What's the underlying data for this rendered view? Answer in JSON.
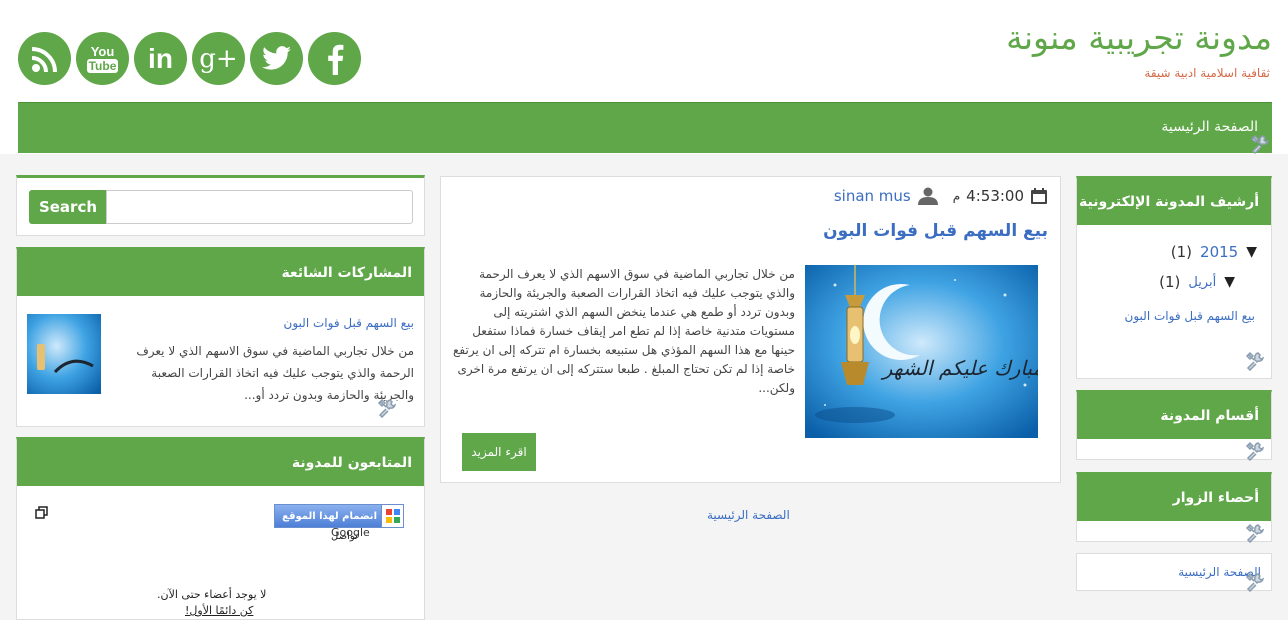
{
  "header": {
    "blog_title": "مدونة تجريبية منونة",
    "blog_description": "ثقافية اسلامية ادبية شيقة",
    "social_icons": [
      "rss-icon",
      "youtube-icon",
      "linkedin-icon",
      "google-plus-icon",
      "twitter-icon",
      "facebook-icon"
    ],
    "youtube_text_top": "You",
    "youtube_text_bottom": "Tube",
    "linkedin_text": "in",
    "gplus_text": "g+"
  },
  "nav": {
    "home": "الصفحة الرئيسية"
  },
  "right_sidebar": {
    "archive_title": "أرشيف المدونة الإلكترونية",
    "year": "2015",
    "year_count": "(1)",
    "month": "أبريل",
    "month_count": "(1)",
    "post": "بيع السهم قبل فوات البون",
    "sections_title": "أقسام المدونة",
    "stats_title": "أحصاء الزوار",
    "home_link": "الصفحة الرئيسية"
  },
  "post": {
    "time": "4:53:00",
    "ampm": "م",
    "author": "sinan mus",
    "title": "بيع السهم قبل فوات البون",
    "excerpt": "من خلال تجاربي الماضية في سوق الاسهم الذي لا يعرف الرحمة والذي يتوجب عليك فيه اتخاذ القرارات الصعبة والجريئة والحازمة وبدون تردد أو طمع هي عندما ينخض السهم الذي اشتريته إلى مستويات متدنية خاصة إذا لم تطع امر إيقاف خسارة فماذا ستفعل حينها مع هذا السهم المؤذي هل ستبيعه بخسارة ام تتركه إلى ان يرتفع خاصة إذا لم تكن تحتاج المبلغ . طبعا ستتركه إلى ان يرتفع مرة اخرى ولكن...",
    "read_more": "اقرء المزيد",
    "image_text": "مبارك عليكم الشهر"
  },
  "center_home_link": "الصفحة الرئيسية",
  "left_sidebar": {
    "search_button": "Search",
    "search_placeholder": "",
    "popular_title": "المشاركات الشائعة",
    "popular_post_title": "بيع السهم قبل فوات البون",
    "popular_post_excerpt": "من خلال تجاربي الماضية في سوق الاسهم الذي لا يعرف الرحمة والذي يتوجب عليك فيه اتخاذ القرارات الصعبة والجريئة والحازمة وبدون تردد أو...",
    "followers_title": "المتابعون للمدونة",
    "join_button": "انضمام لهذا الموقع",
    "google_caption_1": "تواصل",
    "google_caption_2": "Google",
    "no_members": "لا يوجد أعضاء حتى الآن.",
    "be_first": "كن دائمًا الأول!"
  },
  "colors": {
    "accent": "#5fa748",
    "link": "#3b6ec2",
    "desc": "#d46a4a"
  }
}
